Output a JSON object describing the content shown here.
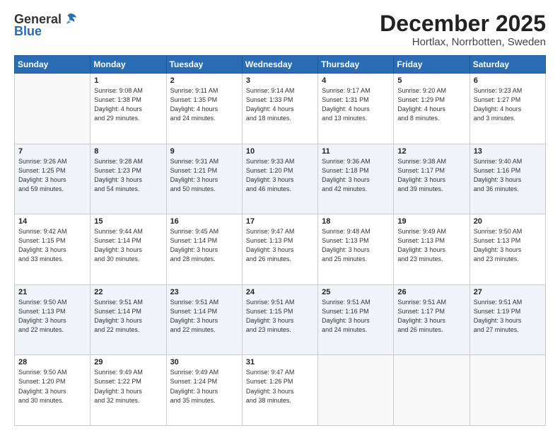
{
  "logo": {
    "general": "General",
    "blue": "Blue"
  },
  "title": "December 2025",
  "subtitle": "Hortlax, Norrbotten, Sweden",
  "days_header": [
    "Sunday",
    "Monday",
    "Tuesday",
    "Wednesday",
    "Thursday",
    "Friday",
    "Saturday"
  ],
  "weeks": [
    [
      {
        "day": "",
        "info": ""
      },
      {
        "day": "1",
        "info": "Sunrise: 9:08 AM\nSunset: 1:38 PM\nDaylight: 4 hours\nand 29 minutes."
      },
      {
        "day": "2",
        "info": "Sunrise: 9:11 AM\nSunset: 1:35 PM\nDaylight: 4 hours\nand 24 minutes."
      },
      {
        "day": "3",
        "info": "Sunrise: 9:14 AM\nSunset: 1:33 PM\nDaylight: 4 hours\nand 18 minutes."
      },
      {
        "day": "4",
        "info": "Sunrise: 9:17 AM\nSunset: 1:31 PM\nDaylight: 4 hours\nand 13 minutes."
      },
      {
        "day": "5",
        "info": "Sunrise: 9:20 AM\nSunset: 1:29 PM\nDaylight: 4 hours\nand 8 minutes."
      },
      {
        "day": "6",
        "info": "Sunrise: 9:23 AM\nSunset: 1:27 PM\nDaylight: 4 hours\nand 3 minutes."
      }
    ],
    [
      {
        "day": "7",
        "info": "Sunrise: 9:26 AM\nSunset: 1:25 PM\nDaylight: 3 hours\nand 59 minutes."
      },
      {
        "day": "8",
        "info": "Sunrise: 9:28 AM\nSunset: 1:23 PM\nDaylight: 3 hours\nand 54 minutes."
      },
      {
        "day": "9",
        "info": "Sunrise: 9:31 AM\nSunset: 1:21 PM\nDaylight: 3 hours\nand 50 minutes."
      },
      {
        "day": "10",
        "info": "Sunrise: 9:33 AM\nSunset: 1:20 PM\nDaylight: 3 hours\nand 46 minutes."
      },
      {
        "day": "11",
        "info": "Sunrise: 9:36 AM\nSunset: 1:18 PM\nDaylight: 3 hours\nand 42 minutes."
      },
      {
        "day": "12",
        "info": "Sunrise: 9:38 AM\nSunset: 1:17 PM\nDaylight: 3 hours\nand 39 minutes."
      },
      {
        "day": "13",
        "info": "Sunrise: 9:40 AM\nSunset: 1:16 PM\nDaylight: 3 hours\nand 36 minutes."
      }
    ],
    [
      {
        "day": "14",
        "info": "Sunrise: 9:42 AM\nSunset: 1:15 PM\nDaylight: 3 hours\nand 33 minutes."
      },
      {
        "day": "15",
        "info": "Sunrise: 9:44 AM\nSunset: 1:14 PM\nDaylight: 3 hours\nand 30 minutes."
      },
      {
        "day": "16",
        "info": "Sunrise: 9:45 AM\nSunset: 1:14 PM\nDaylight: 3 hours\nand 28 minutes."
      },
      {
        "day": "17",
        "info": "Sunrise: 9:47 AM\nSunset: 1:13 PM\nDaylight: 3 hours\nand 26 minutes."
      },
      {
        "day": "18",
        "info": "Sunrise: 9:48 AM\nSunset: 1:13 PM\nDaylight: 3 hours\nand 25 minutes."
      },
      {
        "day": "19",
        "info": "Sunrise: 9:49 AM\nSunset: 1:13 PM\nDaylight: 3 hours\nand 23 minutes."
      },
      {
        "day": "20",
        "info": "Sunrise: 9:50 AM\nSunset: 1:13 PM\nDaylight: 3 hours\nand 23 minutes."
      }
    ],
    [
      {
        "day": "21",
        "info": "Sunrise: 9:50 AM\nSunset: 1:13 PM\nDaylight: 3 hours\nand 22 minutes."
      },
      {
        "day": "22",
        "info": "Sunrise: 9:51 AM\nSunset: 1:14 PM\nDaylight: 3 hours\nand 22 minutes."
      },
      {
        "day": "23",
        "info": "Sunrise: 9:51 AM\nSunset: 1:14 PM\nDaylight: 3 hours\nand 22 minutes."
      },
      {
        "day": "24",
        "info": "Sunrise: 9:51 AM\nSunset: 1:15 PM\nDaylight: 3 hours\nand 23 minutes."
      },
      {
        "day": "25",
        "info": "Sunrise: 9:51 AM\nSunset: 1:16 PM\nDaylight: 3 hours\nand 24 minutes."
      },
      {
        "day": "26",
        "info": "Sunrise: 9:51 AM\nSunset: 1:17 PM\nDaylight: 3 hours\nand 26 minutes."
      },
      {
        "day": "27",
        "info": "Sunrise: 9:51 AM\nSunset: 1:19 PM\nDaylight: 3 hours\nand 27 minutes."
      }
    ],
    [
      {
        "day": "28",
        "info": "Sunrise: 9:50 AM\nSunset: 1:20 PM\nDaylight: 3 hours\nand 30 minutes."
      },
      {
        "day": "29",
        "info": "Sunrise: 9:49 AM\nSunset: 1:22 PM\nDaylight: 3 hours\nand 32 minutes."
      },
      {
        "day": "30",
        "info": "Sunrise: 9:49 AM\nSunset: 1:24 PM\nDaylight: 3 hours\nand 35 minutes."
      },
      {
        "day": "31",
        "info": "Sunrise: 9:47 AM\nSunset: 1:26 PM\nDaylight: 3 hours\nand 38 minutes."
      },
      {
        "day": "",
        "info": ""
      },
      {
        "day": "",
        "info": ""
      },
      {
        "day": "",
        "info": ""
      }
    ]
  ]
}
